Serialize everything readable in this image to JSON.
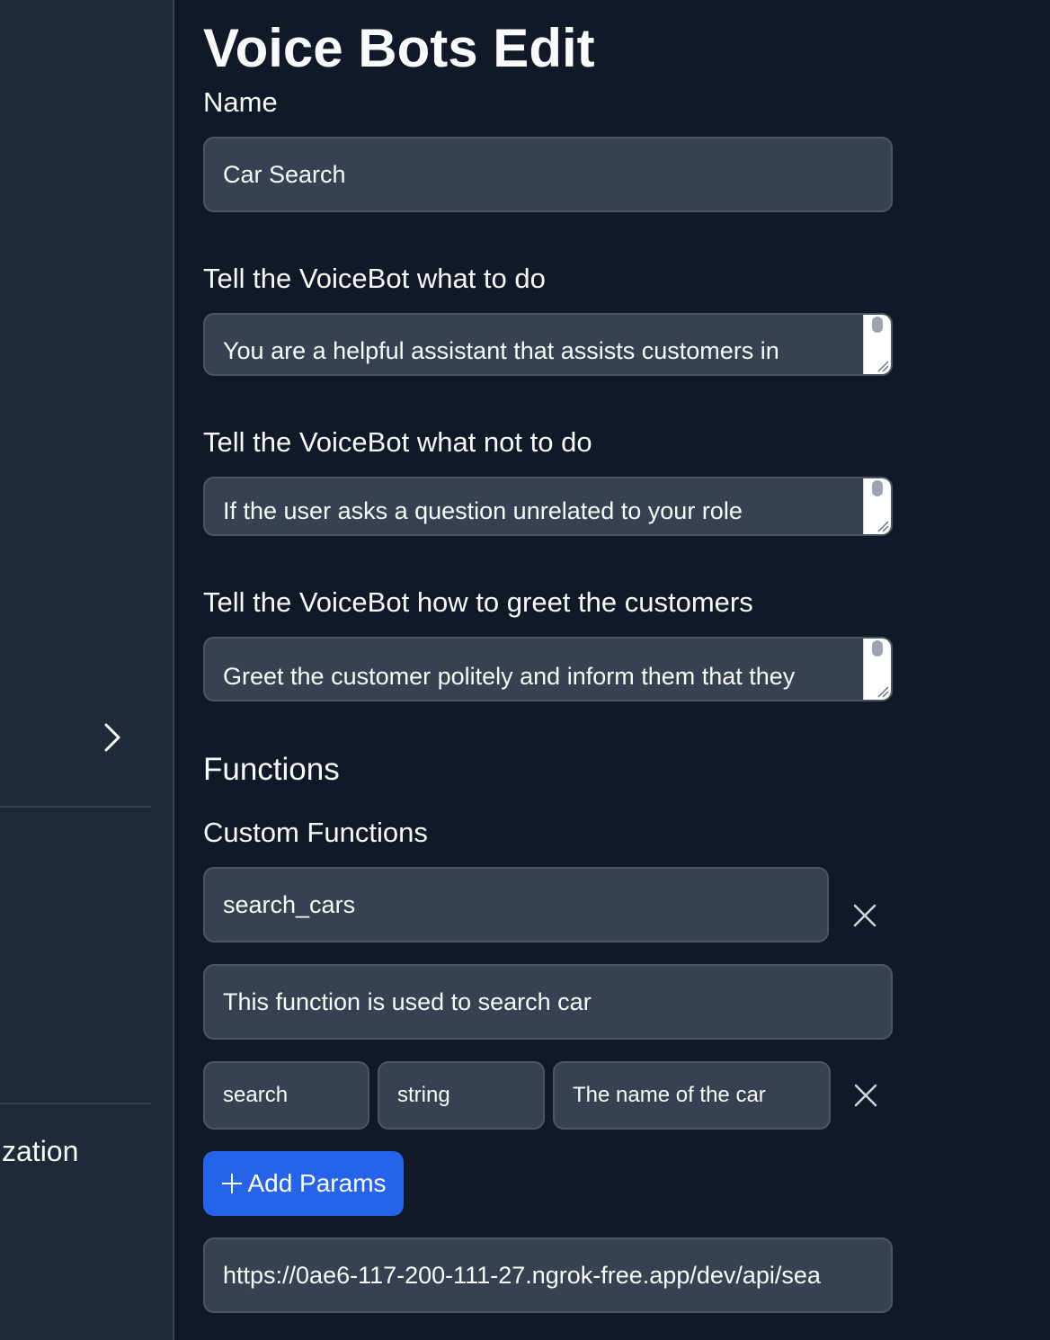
{
  "sidebar": {
    "partial_label": "zation",
    "chevron_icon": "chevron-right-icon"
  },
  "page": {
    "title": "Voice Bots Edit"
  },
  "form": {
    "name_label": "Name",
    "name_value": "Car Search",
    "todo_label": "Tell the VoiceBot what to do",
    "todo_value": "You are a helpful assistant that assists customers in",
    "not_todo_label": "Tell the VoiceBot what not to do",
    "not_todo_value": "If the user asks a question unrelated to your role",
    "greet_label": "Tell the VoiceBot how to greet the customers",
    "greet_value": "Greet the customer politely and inform them that they"
  },
  "functions": {
    "heading": "Functions",
    "custom_heading": "Custom Functions",
    "function_name": "search_cars",
    "function_description": "This function is used to search car",
    "params": [
      {
        "name": "search",
        "type": "string",
        "description": "The name of the car"
      }
    ],
    "add_params_label": "Add Params",
    "endpoint_url": "https://0ae6-117-200-111-27.ngrok-free.app/dev/api/sea"
  }
}
